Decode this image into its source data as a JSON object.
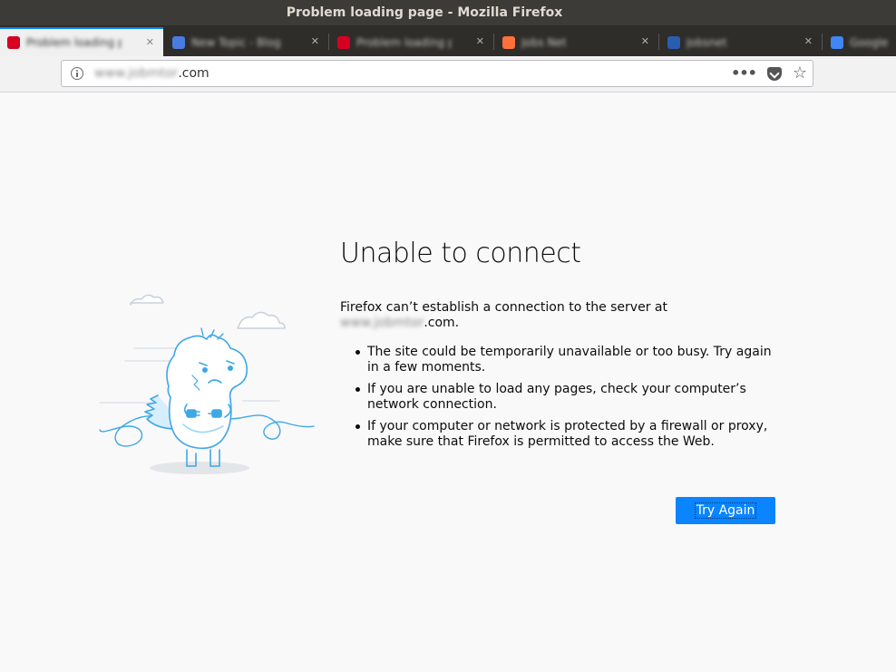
{
  "window": {
    "title": "Problem loading page - Mozilla Firefox"
  },
  "tabs": [
    {
      "title": "Problem loading page",
      "favicon_color": "#d70022",
      "active": true
    },
    {
      "title": "New Topic - Blog",
      "favicon_color": "#4a7be0",
      "active": false
    },
    {
      "title": "Problem loading page",
      "favicon_color": "#d70022",
      "active": false
    },
    {
      "title": "Jobs Net",
      "favicon_color": "#ff7139",
      "active": false
    },
    {
      "title": "Jobsnet",
      "favicon_color": "#2a5db0",
      "active": false
    },
    {
      "title": "Google",
      "favicon_color": "#4285f4",
      "active": false
    }
  ],
  "urlbar": {
    "host_hidden": "www.jobmtor",
    "host_suffix": ".com",
    "more_label": "•••"
  },
  "error": {
    "title": "Unable to connect",
    "desc_line1": "Firefox can’t establish a connection to the server at",
    "desc_host_hidden": "www.jobmtor",
    "desc_host_suffix": ".com.",
    "reasons": [
      "The site could be temporarily unavailable or too busy. Try again in a few moments.",
      "If you are unable to load any pages, check your computer’s network connection.",
      "If your computer or network is protected by a firewall or proxy, make sure that Firefox is permitted to access the Web."
    ],
    "button_label": "Try Again"
  },
  "colors": {
    "accent": "#0a84ff",
    "titlebar": "#3c3b37",
    "illustration": "#3ea7e6"
  }
}
